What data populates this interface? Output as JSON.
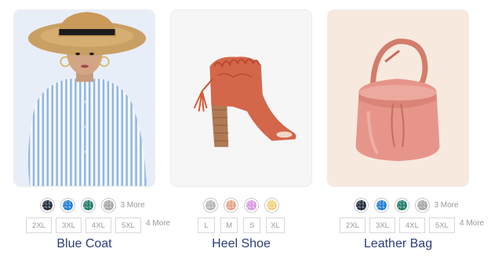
{
  "products": [
    {
      "name": "Blue Coat",
      "swatches": [
        "#1f2a3a",
        "#1e7dd6",
        "#1f7a68",
        "#a6a6a6"
      ],
      "more_colors": "3 More",
      "sizes": [
        "2XL",
        "3XL",
        "4XL",
        "5XL"
      ],
      "more_sizes": "4 More"
    },
    {
      "name": "Heel Shoe",
      "swatches": [
        "#b5b5b5",
        "#e6a287",
        "#d99ae0",
        "#f0d27a"
      ],
      "more_colors": "",
      "sizes": [
        "L",
        "M",
        "S",
        "XL"
      ],
      "more_sizes": ""
    },
    {
      "name": "Leather Bag",
      "swatches": [
        "#1f2a3a",
        "#1e7dd6",
        "#1f7a68",
        "#a6a6a6"
      ],
      "more_colors": "3 More",
      "sizes": [
        "2XL",
        "3XL",
        "4XL",
        "5XL"
      ],
      "more_sizes": "4 More"
    }
  ]
}
